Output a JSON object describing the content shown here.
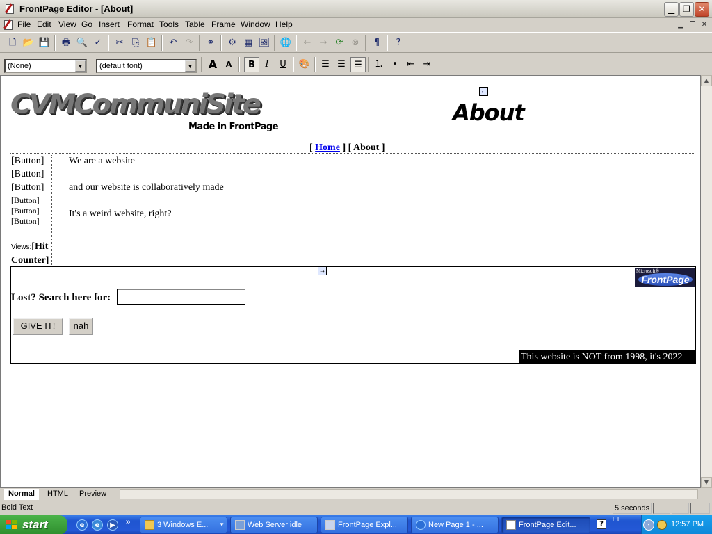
{
  "window": {
    "title": "FrontPage Editor - [About]"
  },
  "menu": [
    "File",
    "Edit",
    "View",
    "Go",
    "Insert",
    "Format",
    "Tools",
    "Table",
    "Frame",
    "Window",
    "Help"
  ],
  "format_toolbar": {
    "style_value": "(None)",
    "font_value": "(default font)"
  },
  "page": {
    "logo_text": "CVMCommuniSite",
    "made_in": "Made in FrontPage",
    "title": "About",
    "nav": {
      "open_1": "[",
      "home": "Home",
      "mid": "] [",
      "about": "About",
      "close": "]"
    },
    "left_buttons": [
      "[Button]",
      "[Button]",
      "[Button]",
      "[Button]",
      "[Button]",
      "[Button]"
    ],
    "body_lines": [
      "We are a website",
      "and our website is collaboratively made",
      "It's a weird website, right?"
    ],
    "views_label": "Views:",
    "hit_counter": "[Hit Counter]",
    "fp_badge_top": "Microsoft®",
    "fp_badge_main": "FrontPage",
    "search_label": "Lost? Search here for:",
    "search_value": "",
    "submit_label": "GIVE IT!",
    "reset_label": "nah",
    "copyright": "This website is NOT from 1998, it's 2022"
  },
  "view_tabs": [
    "Normal",
    "HTML",
    "Preview"
  ],
  "status": {
    "text": "Bold Text",
    "timer": "5 seconds"
  },
  "taskbar": {
    "start_label": "start",
    "chevron": "»",
    "tasks": [
      {
        "label": "3 Windows E...",
        "icon": "folder-icon"
      },
      {
        "label": "Web Server idle",
        "icon": "web-server-icon"
      },
      {
        "label": "FrontPage Expl...",
        "icon": "frontpage-explorer-icon"
      },
      {
        "label": "New Page 1 - ...",
        "icon": "ie-icon"
      },
      {
        "label": "FrontPage Edit...",
        "icon": "frontpage-editor-icon"
      }
    ],
    "clock": "12:57 PM"
  },
  "colors": {
    "taskbar": "#2458d6",
    "start": "#3a9a3a",
    "link": "#0000ee"
  }
}
